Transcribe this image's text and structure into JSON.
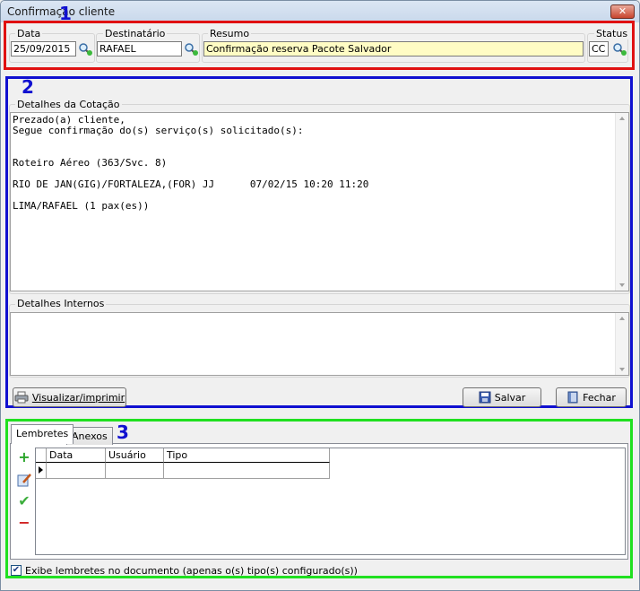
{
  "window": {
    "title": "Confirmação cliente",
    "close": "✕"
  },
  "markers": {
    "one": "1",
    "two": "2",
    "three": "3"
  },
  "header": {
    "data_label": "Data",
    "data_value": "25/09/2015",
    "dest_label": "Destinatário",
    "dest_value": "RAFAEL",
    "resumo_label": "Resumo",
    "resumo_value": "Confirmação reserva Pacote Salvador",
    "status_label": "Status",
    "status_value": "CC"
  },
  "detalhes": {
    "label": "Detalhes da Cotação",
    "lines": [
      "Prezado(a) cliente,",
      "Segue confirmação do(s) serviço(s) solicitado(s):",
      "",
      "",
      "Roteiro Aéreo (363/Svc. 8)",
      "",
      "RIO DE JAN(GIG)/FORTALEZA,(FOR) JJ      07/02/15 10:20 11:20",
      "",
      "LIMA/RAFAEL (1 pax(es))"
    ]
  },
  "internos": {
    "label": "Detalhes Internos"
  },
  "buttons": {
    "visualizar": "Visualizar/imprimir",
    "salvar": "Salvar",
    "fechar": "Fechar"
  },
  "tabs": {
    "lembretes": "Lembretes",
    "anexos": "Anexos"
  },
  "grid": {
    "columns": [
      "Data",
      "Usuário",
      "Tipo"
    ]
  },
  "footer": {
    "checkbox_label": "Exibe lembretes no documento (apenas o(s) tipo(s) configurado(s))",
    "checked": true
  },
  "colors": {
    "red_box": "#e01010",
    "blue_box": "#1010d0",
    "green_box": "#20e020",
    "highlight": "#fffcc4"
  }
}
